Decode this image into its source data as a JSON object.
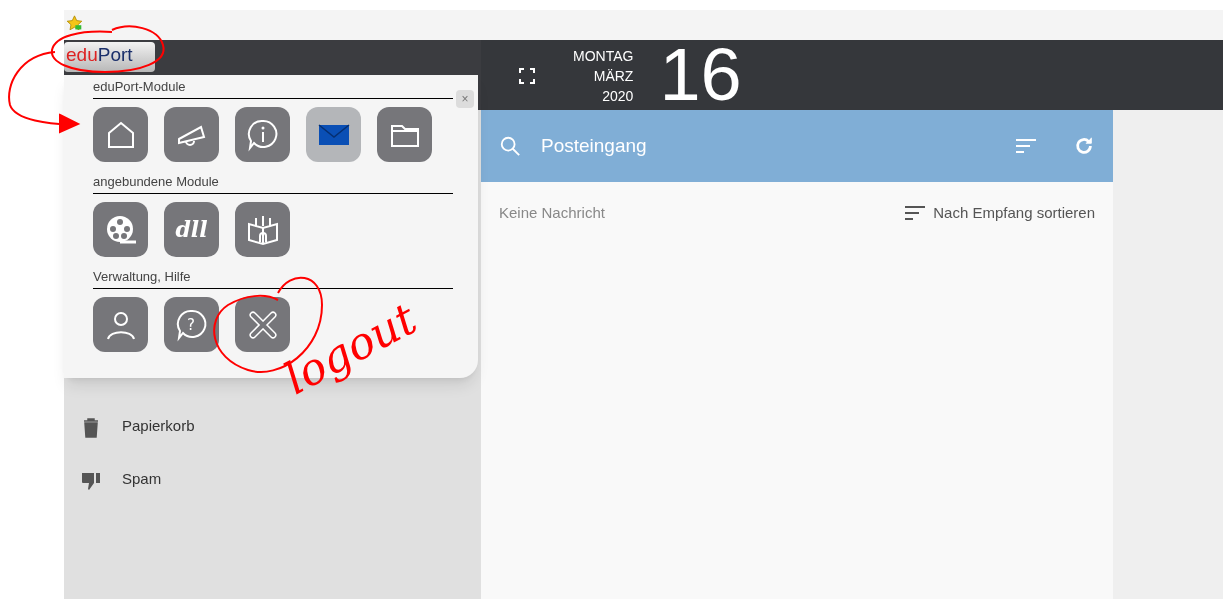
{
  "header": {
    "logo": {
      "prefix": "edu",
      "suffix": "Port"
    },
    "date": {
      "weekday": "MONTAG",
      "month": "MÄRZ",
      "year": "2020",
      "day": "16"
    }
  },
  "module_menu": {
    "sections": [
      {
        "title": "eduPort-Module",
        "tiles": [
          {
            "kind": "home",
            "selected": false
          },
          {
            "kind": "megaphone",
            "selected": false
          },
          {
            "kind": "info",
            "selected": false
          },
          {
            "kind": "mail",
            "selected": true
          },
          {
            "kind": "folder",
            "selected": false
          }
        ]
      },
      {
        "title": "angebundene Module",
        "tiles": [
          {
            "kind": "film",
            "selected": false
          },
          {
            "kind": "script",
            "label": "dll",
            "selected": false
          },
          {
            "kind": "building",
            "selected": false
          }
        ]
      },
      {
        "title": "Verwaltung, Hilfe",
        "tiles": [
          {
            "kind": "user",
            "selected": false
          },
          {
            "kind": "help",
            "label": "?",
            "selected": false
          },
          {
            "kind": "close",
            "selected": false
          }
        ]
      }
    ],
    "close_label": "×"
  },
  "sidebar": {
    "items": [
      {
        "kind": "trash",
        "label": "Papierkorb"
      },
      {
        "kind": "spam",
        "label": "Spam"
      }
    ]
  },
  "mail_header": {
    "title": "Posteingang"
  },
  "mail_list": {
    "empty_text": "Keine Nachricht",
    "sort_label": "Nach Empfang sortieren"
  },
  "annotation": {
    "text": "logout"
  }
}
